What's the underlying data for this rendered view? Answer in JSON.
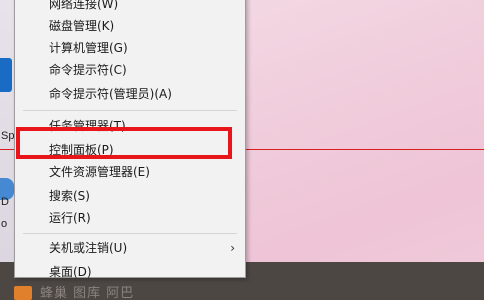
{
  "desktop": {
    "labels": [
      "Sp",
      "D",
      "o"
    ]
  },
  "context_menu": {
    "items": [
      {
        "label": "网络连接(W)"
      },
      {
        "label": "磁盘管理(K)"
      },
      {
        "label": "计算机管理(G)"
      },
      {
        "label": "命令提示符(C)"
      },
      {
        "label": "命令提示符(管理员)(A)"
      },
      {
        "label": "任务管理器(T)"
      },
      {
        "label": "控制面板(P)"
      },
      {
        "label": "文件资源管理器(E)"
      },
      {
        "label": "搜索(S)"
      },
      {
        "label": "运行(R)"
      },
      {
        "label": "关机或注销(U)",
        "submenu_arrow": "›"
      },
      {
        "label": "桌面(D)"
      }
    ]
  },
  "annotation": {
    "highlight_color": "#e8151b",
    "line_color": "#d81e1e"
  },
  "taskbar": {
    "text": "蜂巢 图库 阿巴"
  },
  "colors": {
    "menu_bg": "#f2f2f2",
    "taskbar_bg": "#4d4744",
    "desktop_pink": "#f0ccdb"
  }
}
